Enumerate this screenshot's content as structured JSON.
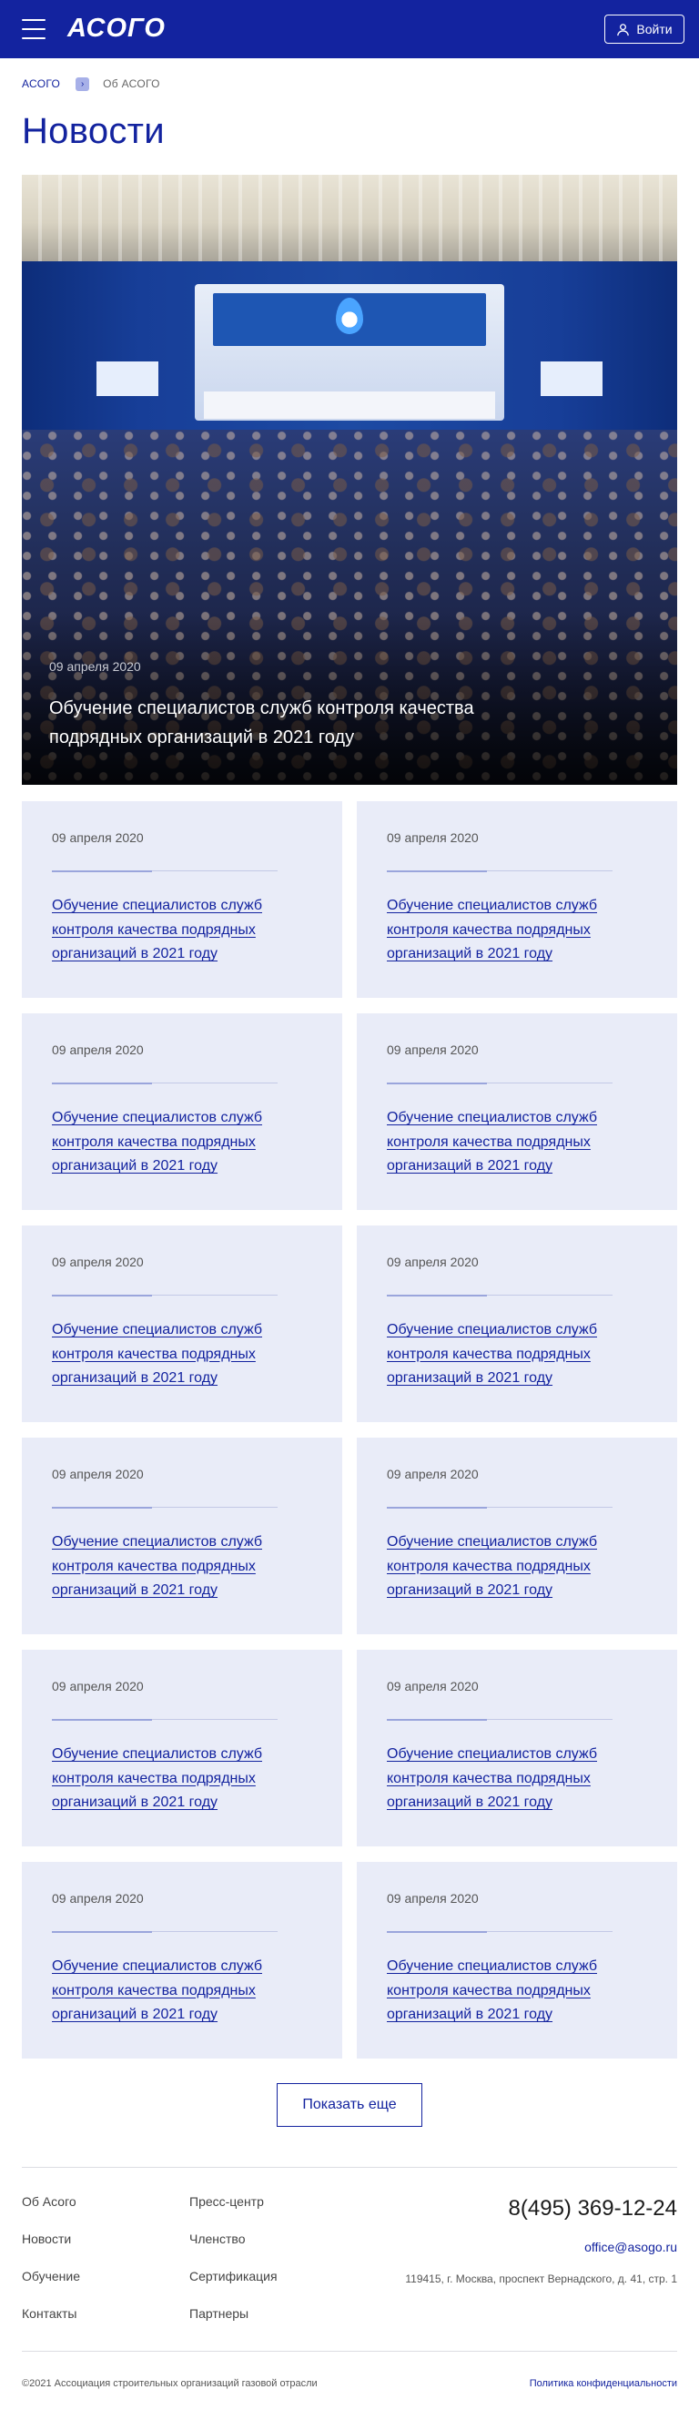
{
  "header": {
    "logo": "АСОГО",
    "login_label": "Войти",
    "bg_color": "#13239f"
  },
  "breadcrumb": {
    "home": "АСОГО",
    "current": "Об АСОГО"
  },
  "page_title": "Новости",
  "hero": {
    "date": "09 апреля 2020",
    "title": "Обучение специалистов служб контроля качества подрядных организаций в 2021 году"
  },
  "news": [
    {
      "date": "09 апреля 2020",
      "title": "Обучение специалистов служб контроля качества подрядных организаций в 2021 году"
    },
    {
      "date": "09 апреля 2020",
      "title": "Обучение специалистов служб контроля качества подрядных организаций в 2021 году"
    },
    {
      "date": "09 апреля 2020",
      "title": "Обучение специалистов служб контроля качества подрядных организаций в 2021 году"
    },
    {
      "date": "09 апреля 2020",
      "title": "Обучение специалистов служб контроля качества подрядных организаций в 2021 году"
    },
    {
      "date": "09 апреля 2020",
      "title": "Обучение специалистов служб контроля качества подрядных организаций в 2021 году"
    },
    {
      "date": "09 апреля 2020",
      "title": "Обучение специалистов служб контроля качества подрядных организаций в 2021 году"
    },
    {
      "date": "09 апреля 2020",
      "title": "Обучение специалистов служб контроля качества подрядных организаций в 2021 году"
    },
    {
      "date": "09 апреля 2020",
      "title": "Обучение специалистов служб контроля качества подрядных организаций в 2021 году"
    },
    {
      "date": "09 апреля 2020",
      "title": "Обучение специалистов служб контроля качества подрядных организаций в 2021 году"
    },
    {
      "date": "09 апреля 2020",
      "title": "Обучение специалистов служб контроля качества подрядных организаций в 2021 году"
    },
    {
      "date": "09 апреля 2020",
      "title": "Обучение специалистов служб контроля качества подрядных организаций в 2021 году"
    },
    {
      "date": "09 апреля 2020",
      "title": "Обучение специалистов служб контроля качества подрядных организаций в 2021 году"
    }
  ],
  "more_label": "Показать еще",
  "footer": {
    "col1": [
      "Об Асого",
      "Новости",
      "Обучение",
      "Контакты"
    ],
    "col2": [
      "Пресс-центр",
      "Членство",
      "Сертификация",
      "Партнеры"
    ],
    "phone": "8(495) 369-12-24",
    "email": "office@asogo.ru",
    "address": "119415, г. Москва, проспект Вернадского, д. 41, стр. 1",
    "copyright": "©2021 Ассоциация строительных организаций газовой отрасли",
    "privacy": "Политика конфиденциальности"
  }
}
